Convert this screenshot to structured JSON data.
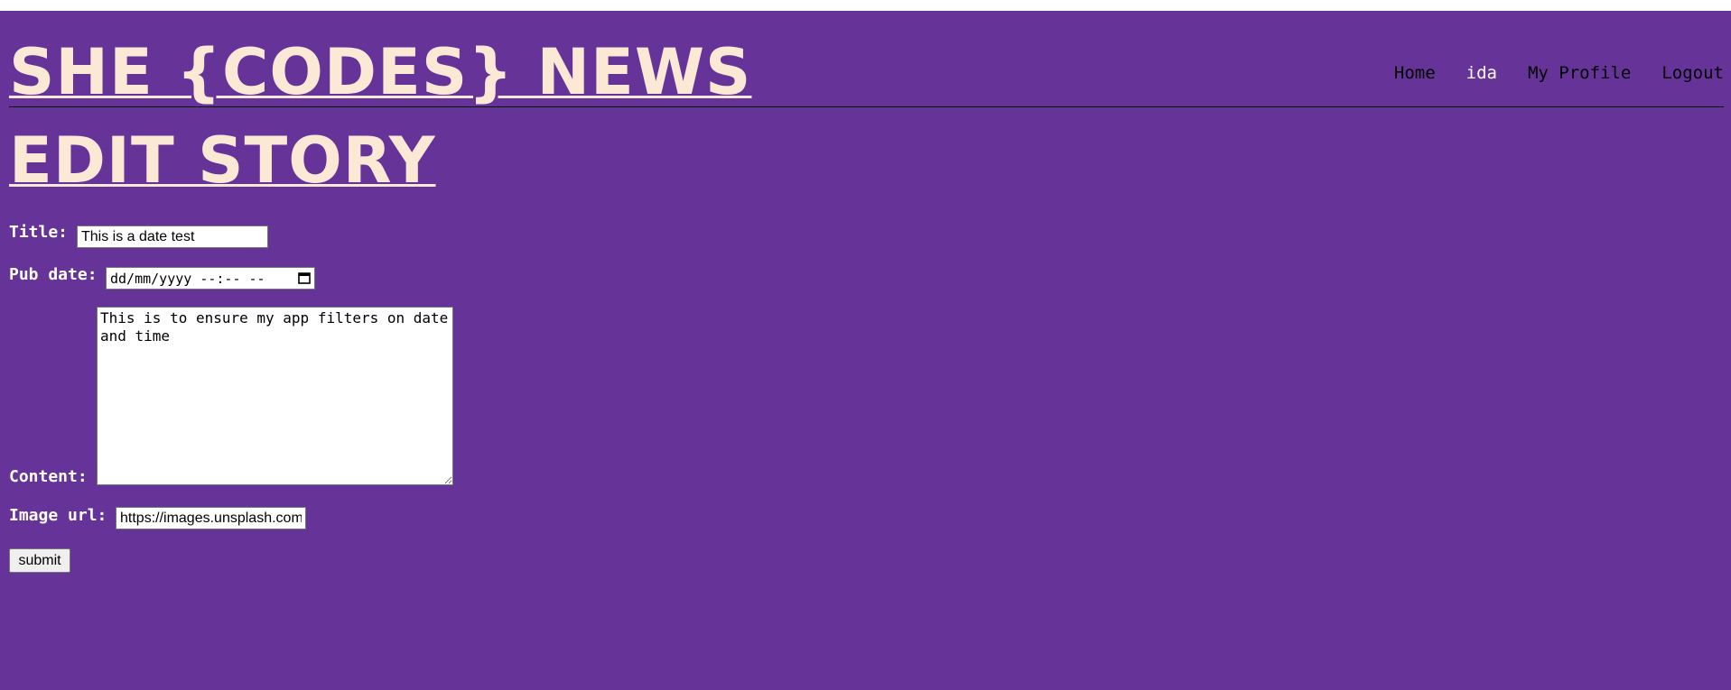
{
  "header": {
    "site_title": "SHE {CODES} NEWS",
    "nav": {
      "home": "Home",
      "user": "ida",
      "profile": "My Profile",
      "logout": "Logout"
    }
  },
  "page_title": "EDIT STORY",
  "form": {
    "title_label": "Title:",
    "title_value": "This is a date test",
    "pub_date_label": "Pub date:",
    "pub_date_placeholder": "dd/mm/yyyy --:-- --",
    "content_label": "Content:",
    "content_value": "This is to ensure my app filters on date and time",
    "image_url_label": "Image url:",
    "image_url_value": "https://images.unsplash.com",
    "submit_label": "submit"
  },
  "colors": {
    "background": "#663399",
    "heading": "#fbe9d6"
  }
}
